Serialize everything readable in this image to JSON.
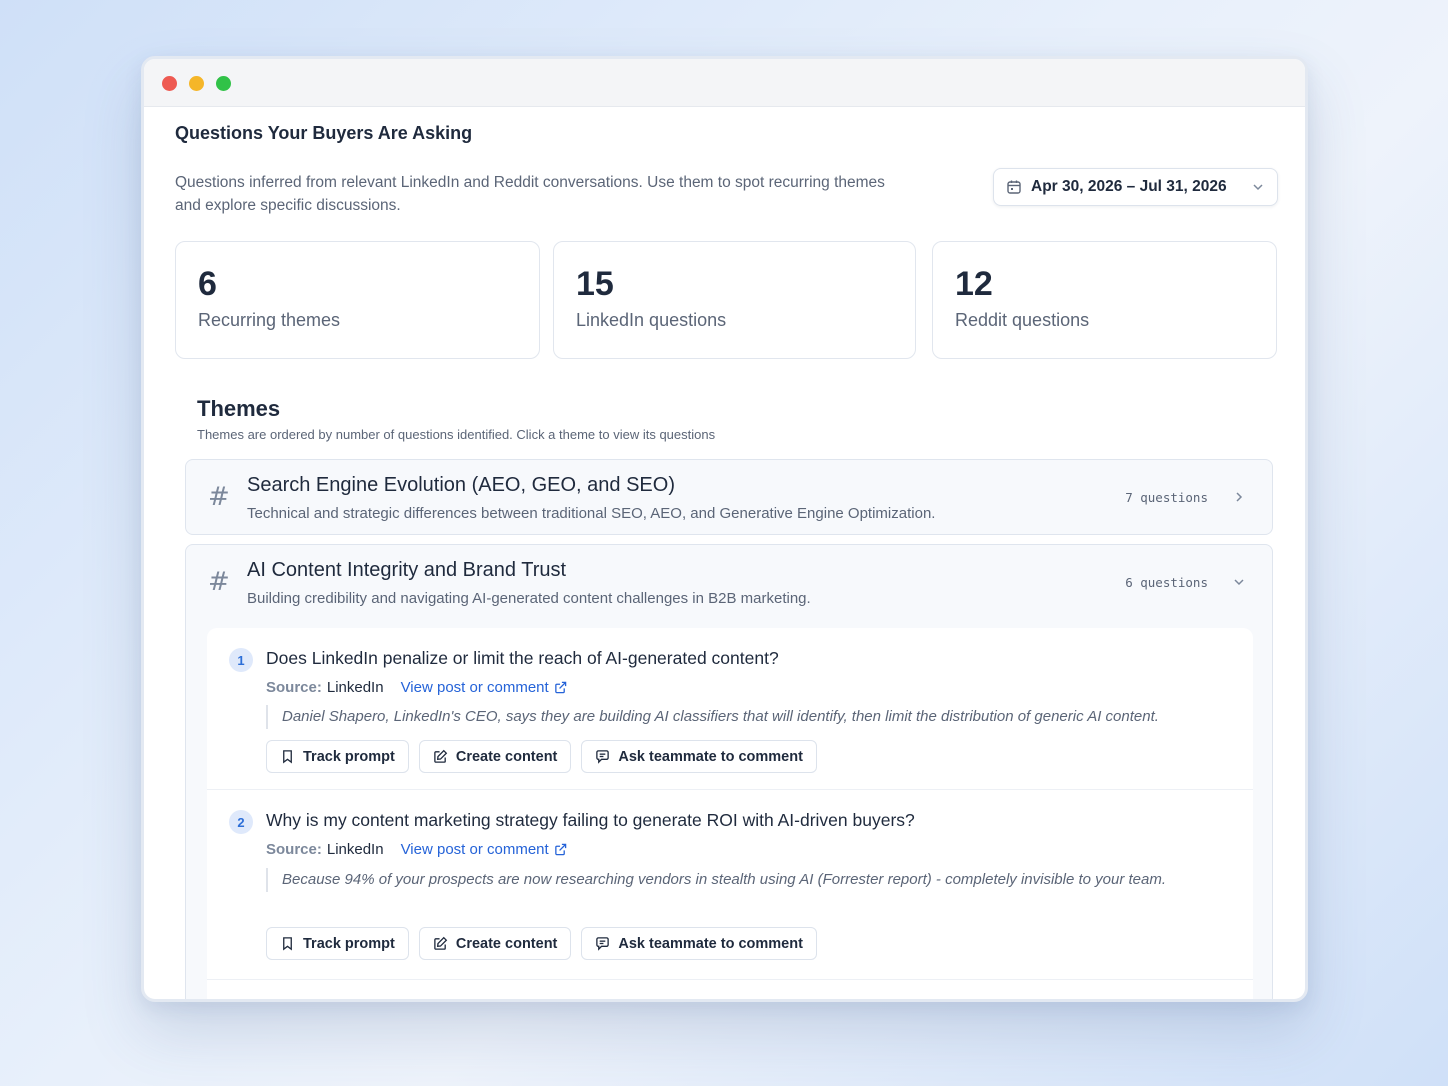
{
  "header": {
    "title": "Questions Your Buyers Are Asking",
    "description": "Questions inferred from relevant LinkedIn and Reddit conversations. Use them to spot recurring themes and explore specific discussions.",
    "date_range": "Apr 30, 2026 – Jul 31, 2026"
  },
  "stats": [
    {
      "value": "6",
      "label": "Recurring themes"
    },
    {
      "value": "15",
      "label": "LinkedIn questions"
    },
    {
      "value": "12",
      "label": "Reddit questions"
    }
  ],
  "themes_section": {
    "title": "Themes",
    "subtitle": "Themes are ordered by number of questions identified. Click a theme to view its questions"
  },
  "themes": [
    {
      "name": "Search Engine Evolution (AEO, GEO, and SEO)",
      "description": "Technical and strategic differences between traditional SEO, AEO, and Generative Engine Optimization.",
      "count": "7 questions",
      "expanded": false
    },
    {
      "name": "AI Content Integrity and Brand Trust",
      "description": "Building credibility and navigating AI-generated content challenges in B2B marketing.",
      "count": "6 questions",
      "expanded": true
    }
  ],
  "questions": [
    {
      "number": "1",
      "text": "Does LinkedIn penalize or limit the reach of AI-generated content?",
      "source_label": "Source:",
      "source": "LinkedIn",
      "link": "View post or comment",
      "quote": "Daniel Shapero, LinkedIn's CEO, says they are building AI classifiers that will identify, then limit the distribution of generic AI content."
    },
    {
      "number": "2",
      "text": "Why is my content marketing strategy failing to generate ROI with AI-driven buyers?",
      "source_label": "Source:",
      "source": "LinkedIn",
      "link": "View post or comment",
      "quote": "Because 94% of your prospects are now researching vendors in stealth using AI (Forrester report) - completely invisible to your team."
    }
  ],
  "actions": {
    "track": "Track prompt",
    "create": "Create content",
    "ask": "Ask teammate to comment"
  },
  "colors": {
    "accent": "#2563d8",
    "window_close": "#ee5a52",
    "window_minimize": "#f5b629",
    "window_maximize": "#31c248"
  }
}
